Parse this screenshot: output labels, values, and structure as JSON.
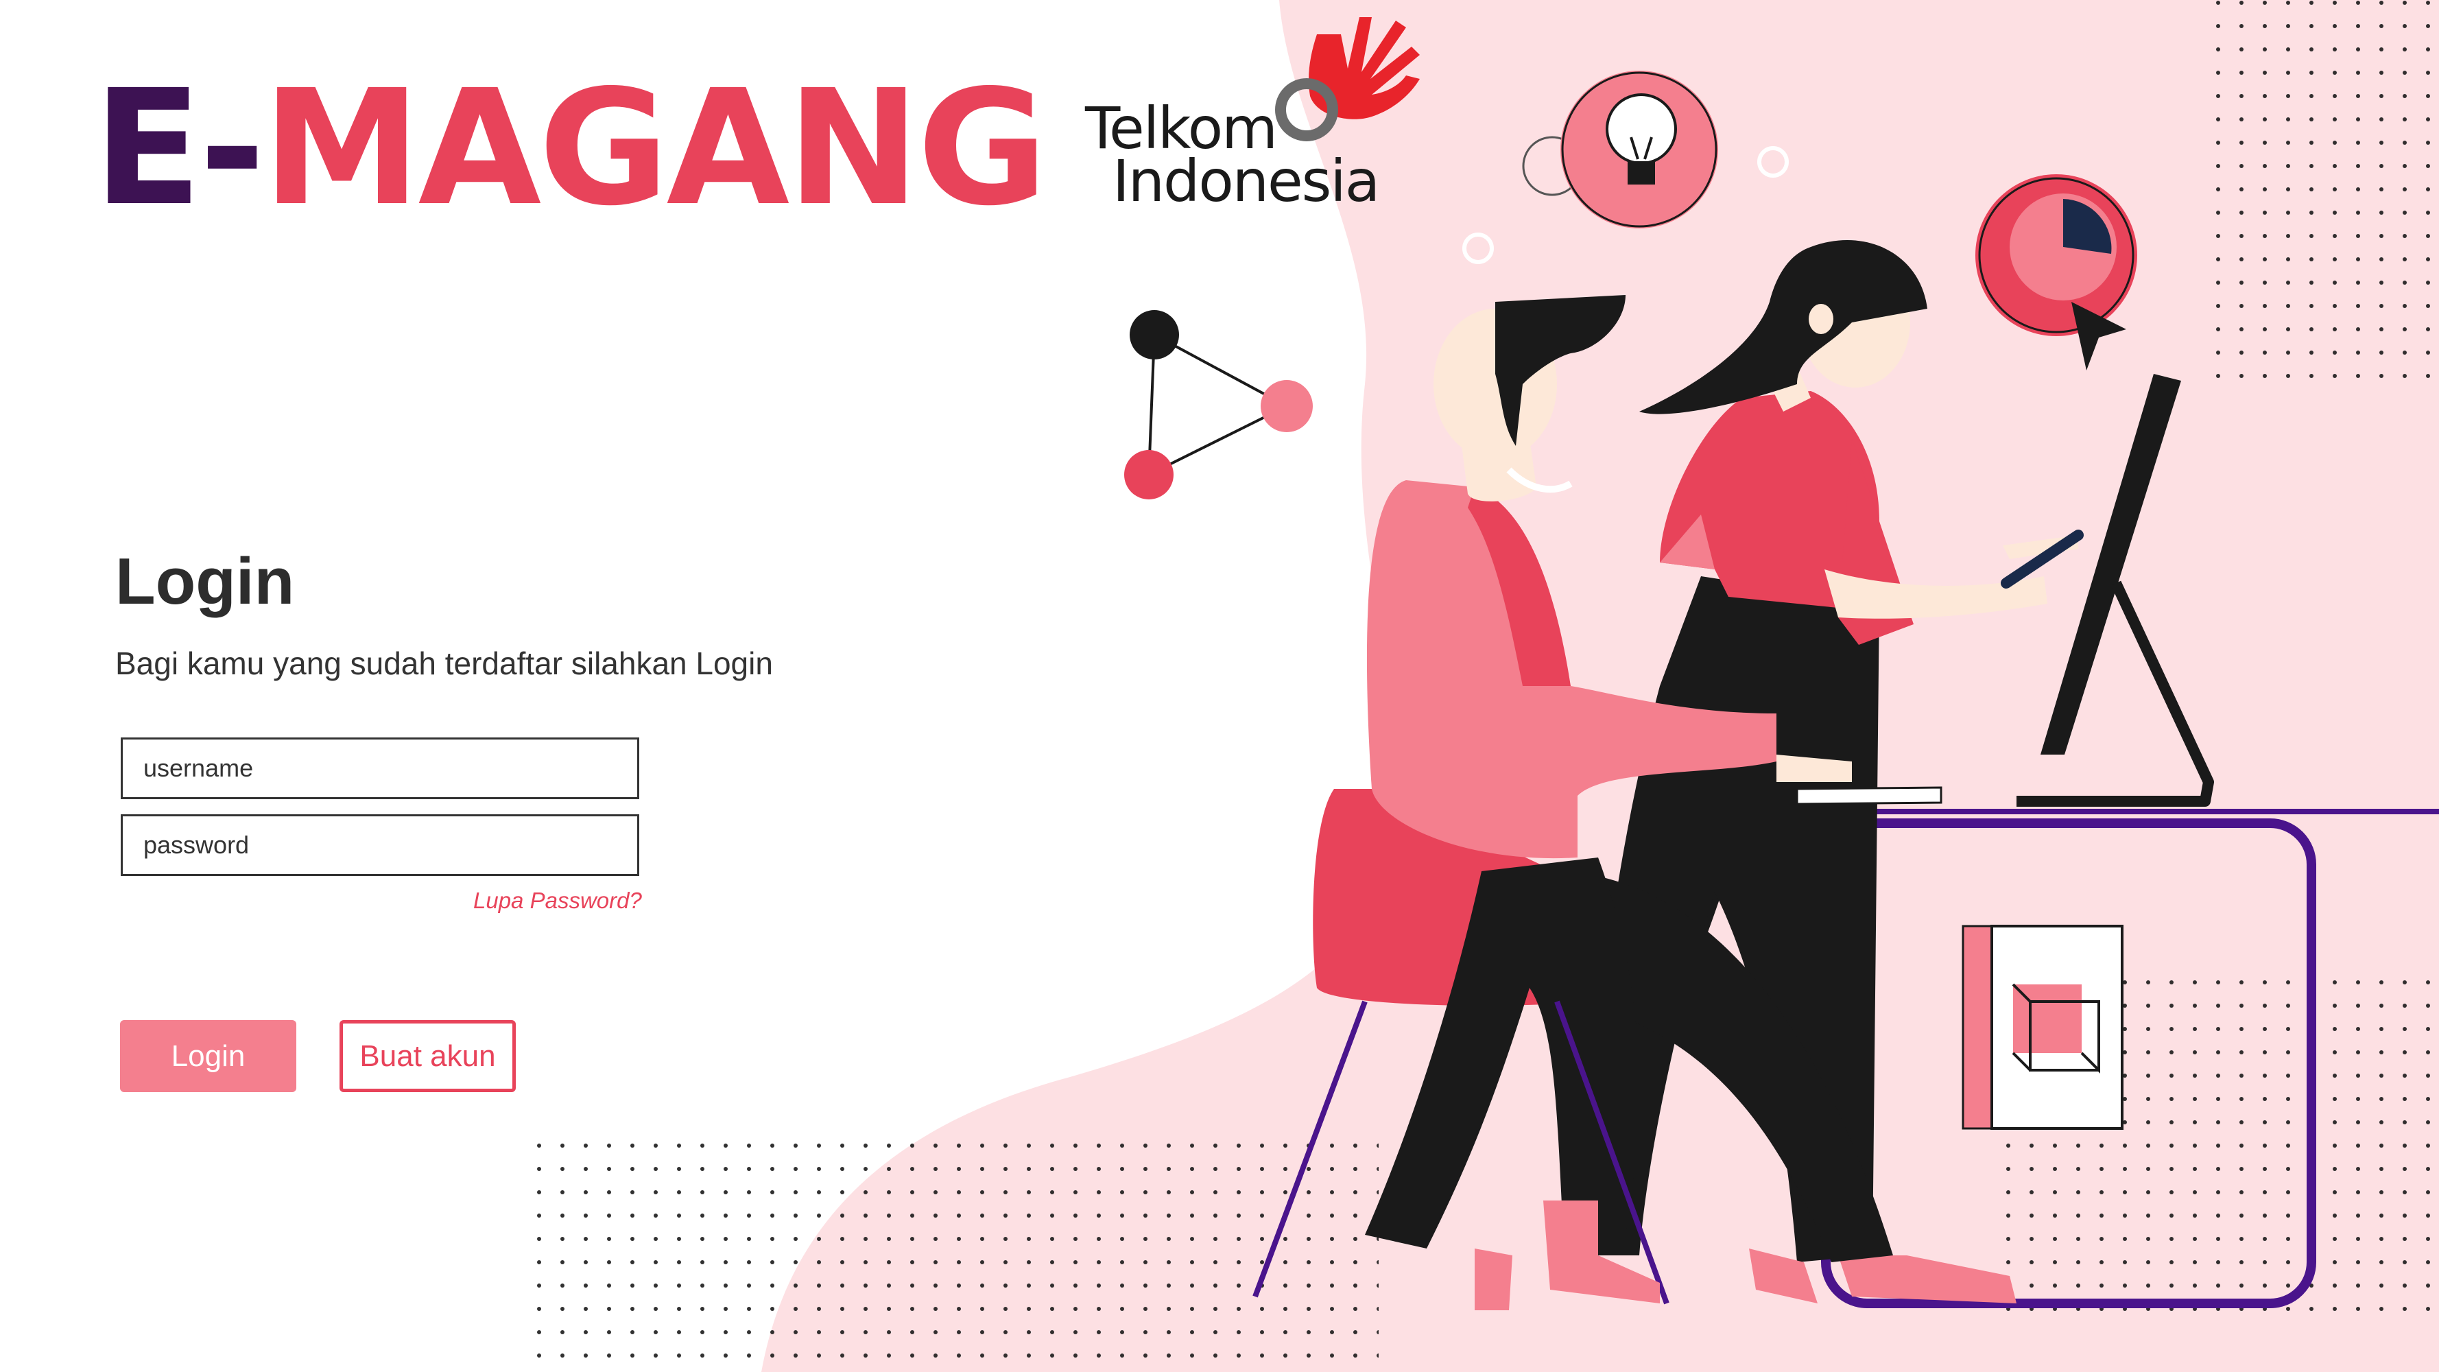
{
  "brand": {
    "prefix": "E-",
    "name": "MAGANG"
  },
  "partner_logo": {
    "line1": "Telkom",
    "line2": "Indonesia",
    "icon": "telkom-hand-logo"
  },
  "login": {
    "title": "Login",
    "subtitle": "Bagi kamu yang sudah terdaftar silahkan Login",
    "username_placeholder": "username",
    "password_placeholder": "password",
    "forgot_label": "Lupa Password?",
    "login_button": "Login",
    "register_button": "Buat akun"
  },
  "illustration": {
    "description_icons": [
      "lightbulb-icon",
      "pie-chart-icon",
      "cursor-icon",
      "network-nodes-icon",
      "cube-icon"
    ]
  },
  "colors": {
    "brand_dark": "#3d1253",
    "brand_red": "#e8435a",
    "button_pink": "#f47f8e",
    "background_pink": "#fde0e3",
    "accent_purple": "#4a148c"
  }
}
